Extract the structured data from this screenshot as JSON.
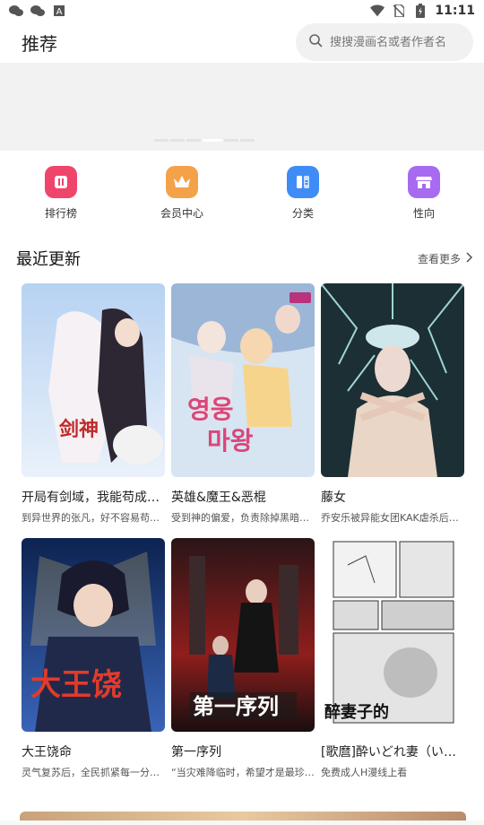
{
  "status_bar": {
    "time": "11:11",
    "left_icons": [
      "wechat-icon",
      "wechat-icon",
      "a-box-icon"
    ],
    "right_icons": [
      "wifi-icon",
      "no-sim-icon",
      "battery-charging-icon"
    ]
  },
  "header": {
    "title": "推荐",
    "search_placeholder": "搜搜漫画名或者作者名"
  },
  "banner": {
    "page_count": 3,
    "active_index": 1
  },
  "quick_nav": [
    {
      "label": "排行榜",
      "icon": "ranking-icon",
      "color": "#f0456a"
    },
    {
      "label": "会员中心",
      "icon": "vip-crown-icon",
      "color": "#f4a24a"
    },
    {
      "label": "分类",
      "icon": "category-icon",
      "color": "#3f8cf6"
    },
    {
      "label": "性向",
      "icon": "store-icon",
      "color": "#a66bf0"
    }
  ],
  "recent": {
    "title": "最近更新",
    "more_label": "查看更多",
    "items": [
      {
        "title": "开局有剑域，我能苟成剑神",
        "subtitle": "到异世界的张凡，好不容易苟到中年",
        "cover_colors": [
          "#8fb6e8",
          "#f0d7e6",
          "#2a2530"
        ]
      },
      {
        "title": "英雄&魔王&恶棍",
        "subtitle": "受到神的偏爱，负责除掉黑暗势力的英雄",
        "cover_colors": [
          "#d8e7f2",
          "#f3c7a2",
          "#6d8fc7"
        ]
      },
      {
        "title": "藤女",
        "subtitle": "乔安乐被异能女团KAK虐杀后重生",
        "cover_colors": [
          "#1a2f33",
          "#9fc7c2",
          "#e9d8cc"
        ]
      },
      {
        "title": "大王饶命",
        "subtitle": "灵气复苏后，全民抓紧每一分每一秒修行",
        "cover_colors": [
          "#0d2350",
          "#e6c35a",
          "#c23a2e"
        ]
      },
      {
        "title": "第一序列",
        "subtitle": "“当灾难降临时，希望才是最珍贵的东西",
        "cover_colors": [
          "#1b1416",
          "#c9342f",
          "#5a1212"
        ]
      },
      {
        "title": "[歌麿]酔いどれ妻（いどれづま）",
        "subtitle": "免费成人H漫线上看",
        "cover_colors": [
          "#ffffff",
          "#d9d9d9",
          "#444444"
        ]
      }
    ]
  }
}
